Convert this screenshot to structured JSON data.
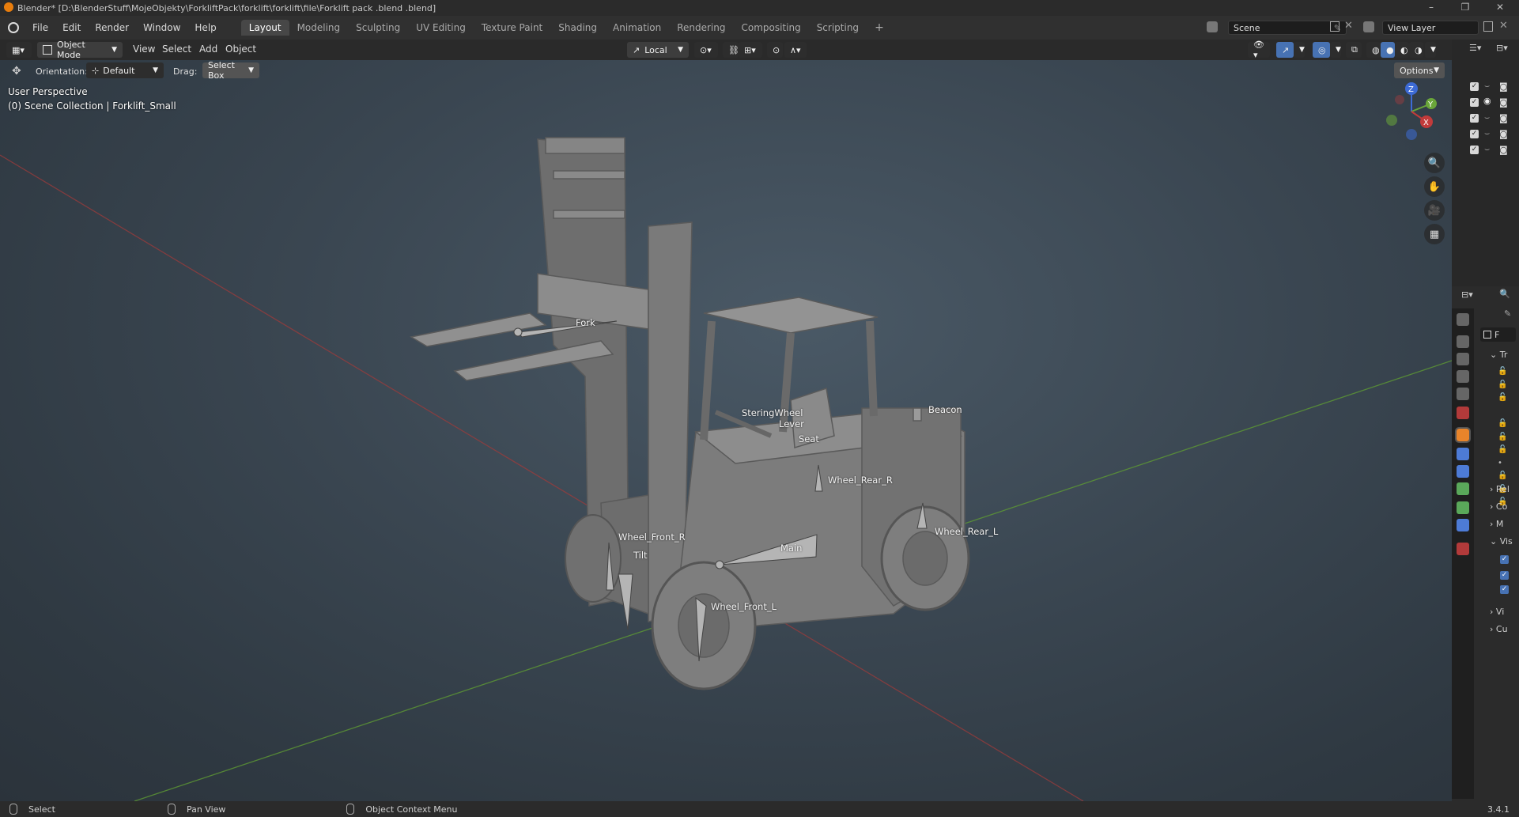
{
  "window": {
    "title": "Blender* [D:\\BlenderStuff\\MojeObjekty\\ForkliftPack\\forklift\\forklift\\file\\Forklift pack .blend .blend]",
    "controls": [
      "–",
      "❐",
      "✕"
    ]
  },
  "menu": [
    "File",
    "Edit",
    "Render",
    "Window",
    "Help"
  ],
  "workspaces": [
    "Layout",
    "Modeling",
    "Sculpting",
    "UV Editing",
    "Texture Paint",
    "Shading",
    "Animation",
    "Rendering",
    "Compositing",
    "Scripting"
  ],
  "active_workspace": "Layout",
  "add_workspace": "+",
  "scene": {
    "name": "Scene",
    "view_layer": "View Layer"
  },
  "header": {
    "mode": "Object Mode",
    "menus": [
      "View",
      "Select",
      "Add",
      "Object"
    ],
    "pivot": "Local",
    "options": "Options"
  },
  "toolbar": {
    "orientation_label": "Orientation:",
    "orientation_value": "Default",
    "drag_label": "Drag:",
    "drag_value": "Select Box"
  },
  "viewport": {
    "view_name": "User Perspective",
    "collection": "(0) Scene Collection | Forklift_Small",
    "gizmo_axes": [
      "Z",
      "Y",
      "X"
    ]
  },
  "bones": [
    {
      "name": "Fork"
    },
    {
      "name": "SteringWheel"
    },
    {
      "name": "Lever"
    },
    {
      "name": "Seat"
    },
    {
      "name": "Beacon"
    },
    {
      "name": "Wheel_Rear_R"
    },
    {
      "name": "Wheel_Rear_L"
    },
    {
      "name": "Wheel_Front_R"
    },
    {
      "name": "Tilt"
    },
    {
      "name": "Main"
    },
    {
      "name": "Wheel_Front_L"
    }
  ],
  "properties": {
    "object_name": "F",
    "sections": [
      {
        "label": "Tr",
        "expanded": true
      },
      {
        "label": "Rel",
        "expanded": false
      },
      {
        "label": "Co",
        "expanded": false
      },
      {
        "label": "M",
        "expanded": false
      },
      {
        "label": "Vis",
        "expanded": true
      },
      {
        "label": "Vi",
        "expanded": false
      },
      {
        "label": "Cu",
        "expanded": false
      }
    ]
  },
  "statusbar": {
    "left": "Select",
    "middle": "Pan View",
    "right": "Object Context Menu",
    "version": "3.4.1"
  },
  "colors": {
    "accent": "#4772b3",
    "axis_x": "#c23b3b",
    "axis_y": "#6aa63a",
    "axis_z": "#3d6bd6",
    "viewport_bg": "#3a4651"
  }
}
